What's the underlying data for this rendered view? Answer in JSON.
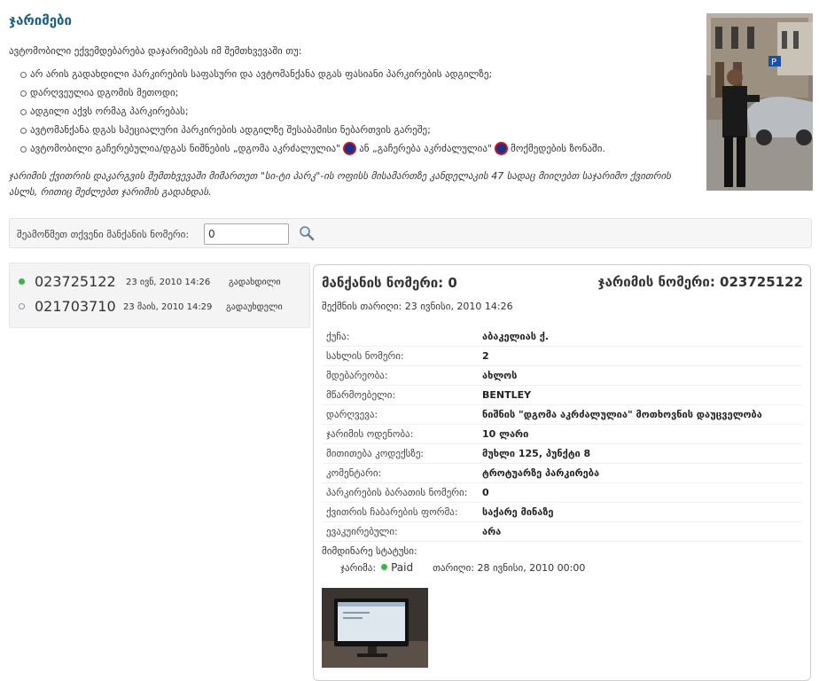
{
  "page": {
    "title": "ჯარიმები",
    "intro": "ავტომობილი ექვემდებარება დაჯარიმებას იმ შემთხვევაში თუ:",
    "reasons": [
      "არ არის გადახდილი პარკირების საფასური და ავტომანქანა დგას ფასიანი პარკირების ადგილზე;",
      "დარღვეულია დგომის მეთოდი;",
      "ადგილი აქვს ორმაგ პარკირებას;",
      "ავტომანქანა დგას სპეციალური პარკირების ადგილზე შესაბამისი ნებართვის გარეშე;",
      {
        "before": "ავტომობილი გაჩერებულია/დგას ნიშნების „დგომა აკრძალულია\"",
        "middle": "ან „გაჩერება აკრძალულია\"",
        "after": "მოქმედების ზონაში."
      }
    ],
    "note": "ჯარიმის ქვითრის დაკარგვის შემთხვევაში მიმართეთ \"სი-ტი პარკ\"-ის ოფისს მისამართზე კანდელაკის 47 სადაც მიიღებთ საჯარიმო ქვითრის ასლს, რითიც შეძლებთ ჯარიმის გადახდას."
  },
  "search": {
    "label": "შეამოწმეთ თქვენი მანქანის ნომერი:",
    "value": "0",
    "button_icon": "search-icon"
  },
  "fines": [
    {
      "number": "023725122",
      "date": "23 ივნ, 2010 14:26",
      "status": "გადახდილი",
      "dot_color": "#39b54a",
      "selected": true
    },
    {
      "number": "021703710",
      "date": "23 მაის, 2010 14:29",
      "status": "გადაუხდელი",
      "dot_color": "#ffffff",
      "selected": false
    }
  ],
  "detail": {
    "plate_label": "მანქანის ნომერი: 0",
    "fine_label": "ჯარიმის ნომერი: 023725122",
    "created": "შექმნის თარიღი: 23 ივნისი, 2010 14:26",
    "fields": [
      {
        "key": "ქუჩა:",
        "value": "აბაკელიას ქ."
      },
      {
        "key": "სახლის ნომერი:",
        "value": "2"
      },
      {
        "key": "მდებარეობა:",
        "value": "ახლოს"
      },
      {
        "key": "მწარმოებელი:",
        "value": "BENTLEY"
      },
      {
        "key": "დარღვევა:",
        "value": "ნიშნის \"დგომა აკრძალულია\" მოთხოვნის დაუცველობა"
      },
      {
        "key": "ჯარიმის ოდენობა:",
        "value": "10 ლარი"
      },
      {
        "key": "მითითება კოდექსზე:",
        "value": "მუხლი 125, პუნქტი 8"
      },
      {
        "key": "კომენტარი:",
        "value": "ტროტუარზე პარკირება"
      },
      {
        "key": "პარკირების ბარათის ნომერი:",
        "value": "0"
      },
      {
        "key": "ქვითრის ჩაბარების ფორმა:",
        "value": "საქარე მინაზე"
      },
      {
        "key": "ევაკუირებული:",
        "value": "არა"
      }
    ],
    "current_status_label": "მიმდინარე სტატუსი:",
    "status_fine_label": "ჯარიმა:",
    "status_value": "Paid",
    "status_date": "თარიღი: 28 ივნისი, 2010 00:00"
  },
  "colors": {
    "accent": "#1f5e86",
    "paid": "#39b54a",
    "sign_blue": "#1d2f8a",
    "sign_red": "#c4161c"
  }
}
